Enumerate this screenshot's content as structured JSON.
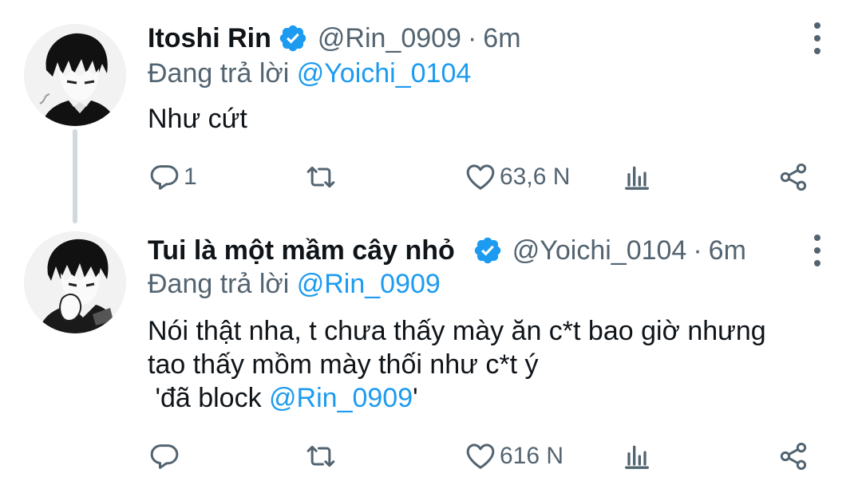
{
  "tweets": [
    {
      "author": "Itoshi Rin",
      "handle": "@Rin_0909",
      "separator": "·",
      "time": "6m",
      "reply_prefix": "Đang trả lời",
      "reply_to": "@Yoichi_0104",
      "text_lines": [
        "Như cứt"
      ],
      "reply_count": "1",
      "like_count": "63,6 N"
    },
    {
      "author": "Tui là một mầm cây nhỏ",
      "handle": "@Yoichi_0104",
      "separator": "·",
      "time": "6m",
      "reply_prefix": "Đang trả lời",
      "reply_to": "@Rin_0909",
      "text_lines": [
        "Nói thật nha, t chưa thấy mày ăn c*t bao giờ nhưng",
        "tao thấy mồm mày thối như c*t ý"
      ],
      "block_prefix": " 'đã block ",
      "block_mention": "@Rin_0909",
      "block_suffix": "'",
      "reply_count": "",
      "like_count": "616 N"
    }
  ],
  "colors": {
    "text": "#0f1419",
    "secondary": "#536471",
    "accent": "#1d9bf0",
    "thread_line": "#cfd9de"
  },
  "icons": [
    "verified-badge-icon",
    "more-options-icon",
    "reply-icon",
    "retweet-icon",
    "like-icon",
    "views-icon",
    "share-icon"
  ]
}
